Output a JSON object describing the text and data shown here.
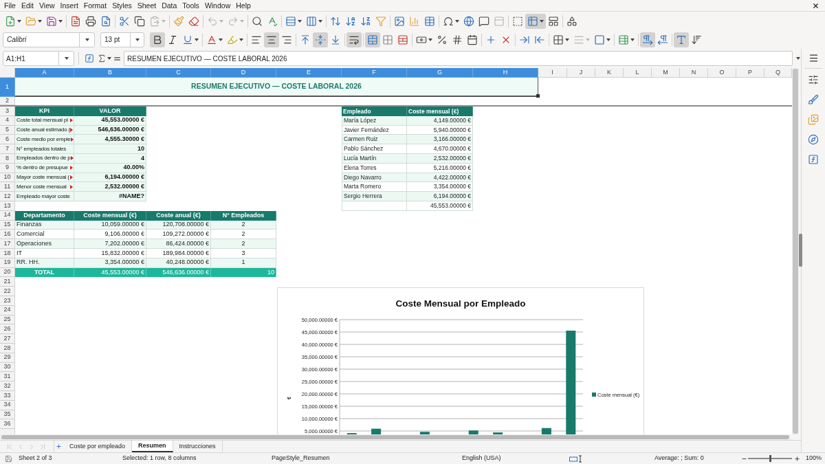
{
  "menu_bar": [
    "File",
    "Edit",
    "View",
    "Insert",
    "Format",
    "Styles",
    "Sheet",
    "Data",
    "Tools",
    "Window",
    "Help"
  ],
  "standard_toolbar": [
    [
      {
        "kind": "split",
        "on": false,
        "disabled": false
      },
      {
        "kind": "split",
        "on": false,
        "disabled": false
      },
      {
        "kind": "split",
        "on": false,
        "disabled": false
      }
    ],
    [
      {
        "kind": "button",
        "on": false,
        "disabled": false
      },
      {
        "kind": "button",
        "on": false,
        "disabled": false
      },
      {
        "kind": "button",
        "on": false,
        "disabled": false
      }
    ],
    [
      {
        "kind": "button",
        "on": false,
        "disabled": false
      },
      {
        "kind": "button",
        "on": false,
        "disabled": false
      },
      {
        "kind": "split",
        "on": false,
        "disabled": true
      }
    ],
    [
      {
        "kind": "button",
        "on": false,
        "disabled": false
      },
      {
        "kind": "button",
        "on": false,
        "disabled": false
      }
    ],
    [
      {
        "kind": "split",
        "on": false,
        "disabled": true
      },
      {
        "kind": "split",
        "on": false,
        "disabled": true
      }
    ],
    [
      {
        "kind": "button",
        "on": false,
        "disabled": false
      },
      {
        "kind": "button",
        "on": false,
        "disabled": false
      }
    ],
    [
      {
        "kind": "split",
        "on": false,
        "disabled": false
      },
      {
        "kind": "split",
        "on": false,
        "disabled": false
      }
    ],
    [
      {
        "kind": "button",
        "on": false,
        "disabled": false
      },
      {
        "kind": "button",
        "on": false,
        "disabled": false
      },
      {
        "kind": "button",
        "on": false,
        "disabled": false
      },
      {
        "kind": "button",
        "on": false,
        "disabled": false
      }
    ],
    [
      {
        "kind": "button",
        "on": false,
        "disabled": false
      },
      {
        "kind": "button",
        "on": false,
        "disabled": false
      },
      {
        "kind": "button",
        "on": false,
        "disabled": false
      }
    ],
    [
      {
        "kind": "split",
        "on": false,
        "disabled": false
      },
      {
        "kind": "button",
        "on": false,
        "disabled": false
      },
      {
        "kind": "button",
        "on": false,
        "disabled": false
      },
      {
        "kind": "button",
        "on": false,
        "disabled": true
      }
    ],
    [
      {
        "kind": "button",
        "on": false,
        "disabled": false
      },
      {
        "kind": "split",
        "on": true,
        "disabled": false
      },
      {
        "kind": "button",
        "on": false,
        "disabled": false
      }
    ],
    [
      {
        "kind": "button",
        "on": false,
        "disabled": false
      }
    ]
  ],
  "formatting_toolbar": {
    "font_name": "Calibri",
    "font_size": "13 pt",
    "groups": [
      [
        {
          "kind": "button",
          "on": true,
          "disabled": false
        },
        {
          "kind": "button",
          "on": false,
          "disabled": false
        },
        {
          "kind": "split",
          "on": false,
          "disabled": false
        }
      ],
      [
        {
          "kind": "split",
          "on": false,
          "disabled": false
        },
        {
          "kind": "split",
          "on": false,
          "disabled": false
        }
      ],
      [
        {
          "kind": "button",
          "on": false,
          "disabled": false
        },
        {
          "kind": "button",
          "on": true,
          "disabled": false
        },
        {
          "kind": "button",
          "on": false,
          "disabled": false
        }
      ],
      [
        {
          "kind": "button",
          "on": false,
          "disabled": false
        },
        {
          "kind": "button",
          "on": true,
          "disabled": false
        },
        {
          "kind": "button",
          "on": false,
          "disabled": false
        }
      ],
      [
        {
          "kind": "button",
          "on": true,
          "disabled": false
        }
      ],
      [
        {
          "kind": "button",
          "on": true,
          "disabled": false
        },
        {
          "kind": "button",
          "on": false,
          "disabled": false
        },
        {
          "kind": "button",
          "on": false,
          "disabled": false
        }
      ],
      [
        {
          "kind": "split",
          "on": false,
          "disabled": false
        },
        {
          "kind": "button",
          "on": false,
          "disabled": false
        },
        {
          "kind": "button",
          "on": false,
          "disabled": false
        },
        {
          "kind": "button",
          "on": false,
          "disabled": false
        }
      ],
      [
        {
          "kind": "button",
          "on": false,
          "disabled": false
        },
        {
          "kind": "button",
          "on": false,
          "disabled": false
        }
      ],
      [
        {
          "kind": "button",
          "on": false,
          "disabled": false
        },
        {
          "kind": "button",
          "on": false,
          "disabled": false
        }
      ],
      [
        {
          "kind": "split",
          "on": false,
          "disabled": false
        },
        {
          "kind": "split",
          "on": false,
          "disabled": true
        },
        {
          "kind": "split",
          "on": false,
          "disabled": false
        }
      ],
      [
        {
          "kind": "split",
          "on": false,
          "disabled": false
        }
      ],
      [
        {
          "kind": "button",
          "on": true,
          "disabled": false
        },
        {
          "kind": "button",
          "on": false,
          "disabled": false
        }
      ],
      [
        {
          "kind": "button",
          "on": true,
          "disabled": false
        },
        {
          "kind": "button",
          "on": false,
          "disabled": false
        }
      ]
    ]
  },
  "formula_bar": {
    "name_box": "A1:H1",
    "formula": "RESUMEN EJECUTIVO — COSTE LABORAL 2026"
  },
  "sheet": {
    "columns": [
      {
        "label": "A",
        "selected": true
      },
      {
        "label": "B",
        "selected": true
      },
      {
        "label": "C",
        "selected": true
      },
      {
        "label": "D",
        "selected": true
      },
      {
        "label": "E",
        "selected": true
      },
      {
        "label": "F",
        "selected": true
      },
      {
        "label": "G",
        "selected": true
      },
      {
        "label": "H",
        "selected": true
      },
      {
        "label": "I",
        "selected": false
      },
      {
        "label": "J",
        "selected": false
      },
      {
        "label": "K",
        "selected": false
      },
      {
        "label": "L",
        "selected": false
      },
      {
        "label": "M",
        "selected": false
      },
      {
        "label": "N",
        "selected": false
      },
      {
        "label": "O",
        "selected": false
      },
      {
        "label": "P",
        "selected": false
      },
      {
        "label": "Q",
        "selected": false
      }
    ],
    "rows": [
      {
        "label": "1",
        "selected": true
      },
      {
        "label": "2",
        "selected": false
      },
      {
        "label": "3",
        "selected": false
      },
      {
        "label": "4",
        "selected": false
      },
      {
        "label": "5",
        "selected": false
      },
      {
        "label": "6",
        "selected": false
      },
      {
        "label": "7",
        "selected": false
      },
      {
        "label": "8",
        "selected": false
      },
      {
        "label": "9",
        "selected": false
      },
      {
        "label": "10",
        "selected": false
      },
      {
        "label": "11",
        "selected": false
      },
      {
        "label": "12",
        "selected": false
      },
      {
        "label": "13",
        "selected": false
      },
      {
        "label": "14",
        "selected": false
      },
      {
        "label": "15",
        "selected": false
      },
      {
        "label": "16",
        "selected": false
      },
      {
        "label": "17",
        "selected": false
      },
      {
        "label": "18",
        "selected": false
      },
      {
        "label": "19",
        "selected": false
      },
      {
        "label": "20",
        "selected": false
      },
      {
        "label": "21",
        "selected": false
      },
      {
        "label": "22",
        "selected": false
      },
      {
        "label": "23",
        "selected": false
      },
      {
        "label": "24",
        "selected": false
      },
      {
        "label": "25",
        "selected": false
      },
      {
        "label": "26",
        "selected": false
      },
      {
        "label": "27",
        "selected": false
      },
      {
        "label": "28",
        "selected": false
      },
      {
        "label": "29",
        "selected": false
      },
      {
        "label": "30",
        "selected": false
      },
      {
        "label": "31",
        "selected": false
      },
      {
        "label": "32",
        "selected": false
      },
      {
        "label": "33",
        "selected": false
      },
      {
        "label": "34",
        "selected": false
      },
      {
        "label": "35",
        "selected": false
      },
      {
        "label": "36",
        "selected": false
      }
    ],
    "title_cell": {
      "text": "RESUMEN EJECUTIVO — COSTE LABORAL 2026",
      "selected": true
    },
    "kpi_table": {
      "columns": [
        "KPI",
        "VALOR"
      ],
      "rows": [
        {
          "label": "Coste total mensual pl",
          "truncated": true,
          "value": "45,553.00000 €"
        },
        {
          "label": "Coste anual estimado (",
          "truncated": true,
          "value": "546,636.00000 €"
        },
        {
          "label": "Coste medio por emple",
          "truncated": true,
          "value": "4,555.30000 €"
        },
        {
          "label": "N° empleados totales",
          "truncated": false,
          "value": "10"
        },
        {
          "label": "Empleados dentro de p",
          "truncated": true,
          "value": "4"
        },
        {
          "label": "% dentro de presupue",
          "truncated": true,
          "value": "40.00%"
        },
        {
          "label": "Mayor coste mensual (",
          "truncated": true,
          "value": "6,194.00000 €"
        },
        {
          "label": "Menor coste mensual",
          "truncated": true,
          "value": "2,532.00000 €"
        },
        {
          "label": "Empleado mayor coste",
          "truncated": false,
          "value": "#NAME?"
        }
      ]
    },
    "employee_table": {
      "columns": [
        "Empleado",
        "Coste mensual (€)"
      ],
      "rows": [
        {
          "name": "María López",
          "cost": "4,149.00000 €"
        },
        {
          "name": "Javier Fernández",
          "cost": "5,940.00000 €"
        },
        {
          "name": "Carmen Ruiz",
          "cost": "3,166.00000 €"
        },
        {
          "name": "Pablo Sánchez",
          "cost": "4,670.00000 €"
        },
        {
          "name": "Lucía Martín",
          "cost": "2,532.00000 €"
        },
        {
          "name": "Elena Torres",
          "cost": "5,216.00000 €"
        },
        {
          "name": "Diego Navarro",
          "cost": "4,422.00000 €"
        },
        {
          "name": "Marta Romero",
          "cost": "3,354.00000 €"
        },
        {
          "name": "Sergio Herrera",
          "cost": "6,194.00000 €"
        }
      ],
      "total": "45,553.00000 €"
    },
    "department_table": {
      "columns": [
        "Departamento",
        "Coste mensual (€)",
        "Coste anual (€)",
        "N° Empleados"
      ],
      "rows": [
        [
          "Finanzas",
          "10,059.00000 €",
          "120,708.00000 €",
          "2"
        ],
        [
          "Comercial",
          "9,106.00000 €",
          "109,272.00000 €",
          "2"
        ],
        [
          "Operaciones",
          "7,202.00000 €",
          "86,424.00000 €",
          "2"
        ],
        [
          "IT",
          "15,832.00000 €",
          "189,984.00000 €",
          "3"
        ],
        [
          "RR. HH.",
          "3,354.00000 €",
          "40,248.00000 €",
          "1"
        ]
      ],
      "total": [
        "TOTAL",
        "45,553.00000 €",
        "546,636.00000 €",
        "10"
      ]
    },
    "chart": {
      "chart_data": {
        "type": "bar",
        "title": "Coste Mensual por Empleado",
        "ylabel": "€",
        "series": [
          {
            "name": "Coste mensual (€)",
            "color": "#177a6b",
            "values": [
              4149,
              5940,
              null,
              4670,
              null,
              5216,
              4422,
              null,
              6194,
              45553
            ]
          }
        ],
        "ylim": [
          0,
          50000
        ],
        "yticks": [
          {
            "value": 5000,
            "label": "5,000.00000 €"
          },
          {
            "value": 10000,
            "label": "10,000.00000 €"
          },
          {
            "value": 15000,
            "label": "15,000.00000 €"
          },
          {
            "value": 20000,
            "label": "20,000.00000 €"
          },
          {
            "value": 25000,
            "label": "25,000.00000 €"
          },
          {
            "value": 30000,
            "label": "30,000.00000 €"
          },
          {
            "value": 35000,
            "label": "35,000.00000 €"
          },
          {
            "value": 40000,
            "label": "40,000.00000 €"
          },
          {
            "value": 45000,
            "label": "45,000.00000 €"
          },
          {
            "value": 50000,
            "label": "50,000.00000 €"
          }
        ],
        "grid": true
      }
    }
  },
  "sheet_navigation": [
    {
      "disabled": true
    },
    {
      "disabled": true
    },
    {
      "disabled": true
    },
    {
      "disabled": true
    }
  ],
  "sheet_tabs": [
    {
      "label": "Coste por empleado",
      "selected": false
    },
    {
      "label": "Resumen",
      "selected": true
    },
    {
      "label": "Instrucciones",
      "selected": false
    }
  ],
  "status_bar": {
    "sheet_position": "Sheet 2 of 3",
    "selection": "Selected: 1 row, 8 columns",
    "page_style": "PageStyle_Resumen",
    "language": "English (USA)",
    "summary": "Average: ; Sum: 0",
    "zoom": {
      "level": 0.5,
      "reading": "100%"
    }
  }
}
